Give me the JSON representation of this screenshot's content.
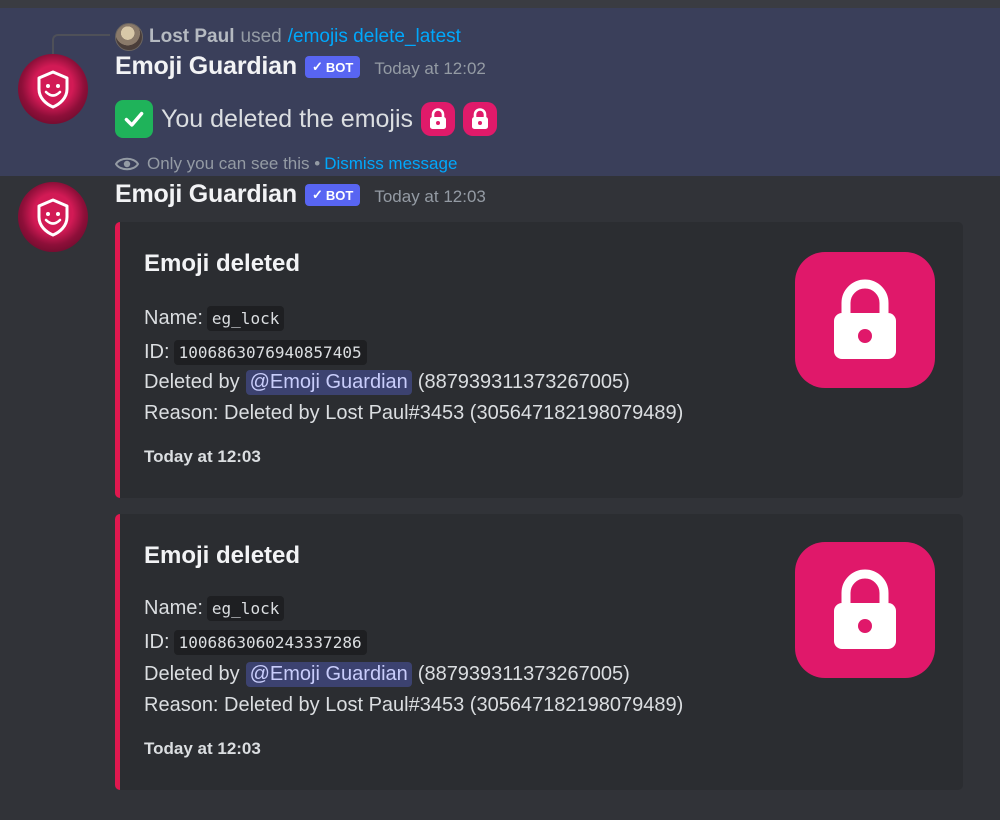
{
  "reply": {
    "author": "Lost Paul",
    "used_text": "used",
    "command": "/emojis delete_latest"
  },
  "messages": [
    {
      "author": "Emoji Guardian",
      "bot_tag": "BOT",
      "timestamp": "Today at 12:02",
      "content": "You deleted the emojis",
      "ephemeral_note": "Only you can see this •",
      "dismiss_label": "Dismiss message"
    },
    {
      "author": "Emoji Guardian",
      "bot_tag": "BOT",
      "timestamp": "Today at 12:03"
    }
  ],
  "embeds": [
    {
      "title": "Emoji deleted",
      "name_label": "Name:",
      "name_value": "eg_lock",
      "id_label": "ID:",
      "id_value": "1006863076940857405",
      "deleted_by_label": "Deleted by",
      "deleted_by_mention": "@Emoji Guardian",
      "deleted_by_id": "(887939311373267005)",
      "reason": "Reason: Deleted by Lost Paul#3453 (305647182198079489)",
      "footer": "Today at 12:03"
    },
    {
      "title": "Emoji deleted",
      "name_label": "Name:",
      "name_value": "eg_lock",
      "id_label": "ID:",
      "id_value": "1006863060243337286",
      "deleted_by_label": "Deleted by",
      "deleted_by_mention": "@Emoji Guardian",
      "deleted_by_id": "(887939311373267005)",
      "reason": "Reason: Deleted by Lost Paul#3453 (305647182198079489)",
      "footer": "Today at 12:03"
    }
  ],
  "icons": {
    "avatar": "shield-smile-icon",
    "check": "check-mark-icon",
    "lock": "lock-icon",
    "eye": "eye-icon"
  },
  "colors": {
    "embed_accent": "#e0184f",
    "lock_pink": "#e0186a",
    "bot_tag": "#5865f2",
    "link": "#00a8fc",
    "check_green": "#1fb35a"
  }
}
